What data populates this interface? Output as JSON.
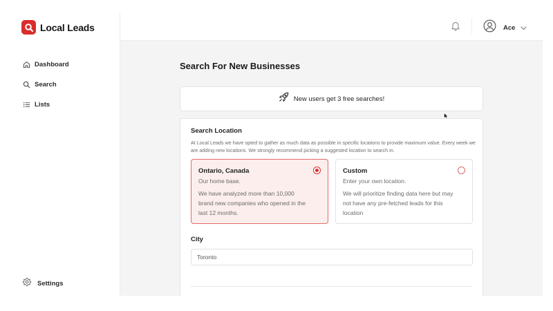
{
  "app": {
    "name": "Local Leads"
  },
  "sidebar": {
    "items": [
      {
        "label": "Dashboard",
        "icon": "home-icon"
      },
      {
        "label": "Search",
        "icon": "search-icon"
      },
      {
        "label": "Lists",
        "icon": "list-icon"
      }
    ],
    "settings_label": "Settings"
  },
  "header": {
    "user_name": "Ace"
  },
  "main": {
    "title": "Search For New Businesses",
    "promo_text": "New users get 3 free searches!",
    "location": {
      "title": "Search Location",
      "description": "At Local Leads we have opted to gather as much data as possible in specific locations to provide maximum value. Every week we are adding new locations. We strongly recommend picking a suggested location to search in.",
      "options": [
        {
          "title": "Ontario, Canada",
          "subtitle": "Our home base.",
          "description": "We have analyzed more than 10,000 brand new companies who opened in the last 12 months.",
          "selected": true
        },
        {
          "title": "Custom",
          "subtitle": "Enter your own location.",
          "description": "We will prioritize finding data here but may not have any pre-fetched leads for this location",
          "selected": false
        }
      ]
    },
    "city": {
      "label": "City",
      "value": "Toronto",
      "placeholder": "Toronto"
    }
  },
  "colors": {
    "accent": "#d92d2d",
    "selected_bg": "#fbeeec",
    "main_bg": "#f4f4f4"
  }
}
